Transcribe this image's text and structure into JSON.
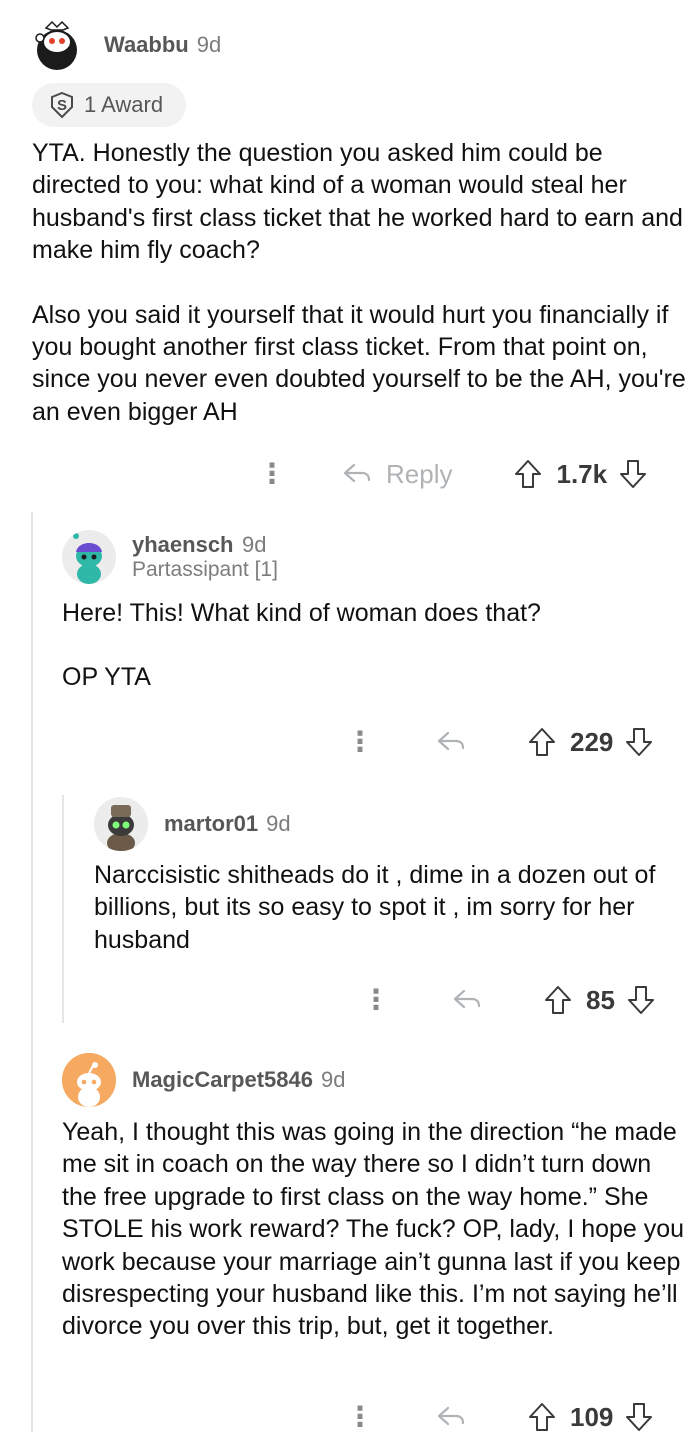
{
  "comments": [
    {
      "username": "Waabbu",
      "age": "9d",
      "award": "1 Award",
      "paragraphs": [
        "YTA. Honestly the question you asked him could be directed to you: what kind of a woman would steal her husband's first class ticket that he worked hard to earn and make him fly coach?",
        "Also you said it yourself that it would hurt you financially if you bought another first class ticket. From that point on, since you never even doubted yourself to be the AH, you're an even bigger AH"
      ],
      "reply_label": "Reply",
      "score": "1.7k"
    },
    {
      "username": "yhaensch",
      "age": "9d",
      "flair": "Partassipant [1]",
      "paragraphs": [
        "Here! This! What kind of woman does that?",
        "OP YTA"
      ],
      "score": "229"
    },
    {
      "username": "martor01",
      "age": "9d",
      "paragraphs": [
        "Narccisistic shitheads do it , dime in a dozen out of billions, but its so easy to spot it , im sorry for her husband"
      ],
      "score": "85"
    },
    {
      "username": "MagicCarpet5846",
      "age": "9d",
      "paragraphs": [
        "Yeah, I thought this was going in the direction “he made me sit in coach on the way there so I didn’t turn down the free upgrade to first class on the way home.” She STOLE his work reward? The fuck? OP, lady, I hope you work because your marriage ain’t gunna last if you keep disrespecting your husband like this. I’m not saying he’ll divorce you over this trip, but, get it together."
      ],
      "score": "109"
    }
  ],
  "icons": {
    "more": "more-vertical-icon",
    "reply": "reply-arrow-icon",
    "upvote": "upvote-arrow-icon",
    "downvote": "downvote-arrow-icon",
    "award": "silver-award-icon"
  }
}
